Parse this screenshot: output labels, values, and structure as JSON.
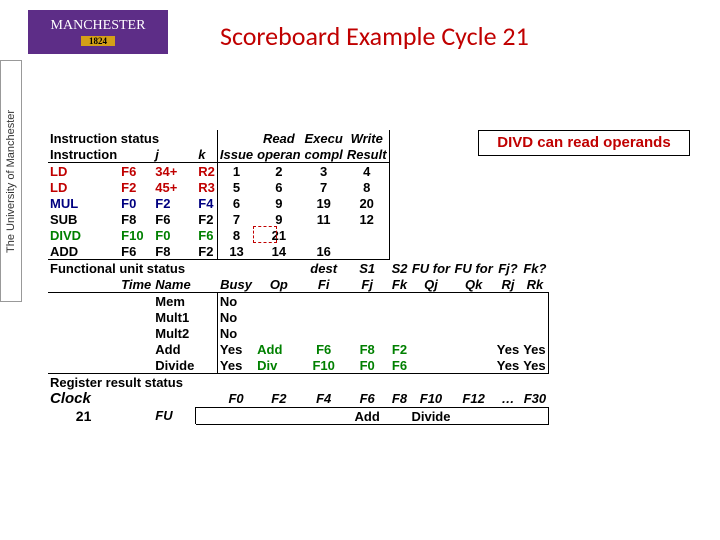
{
  "side_tab": "The University of Manchester",
  "logo": {
    "name": "MANCHESTER",
    "year": "1824"
  },
  "title": "Scoreboard Example Cycle 21",
  "note": "DIVD can read operands",
  "headers": {
    "instr_status": "Instruction status",
    "read": "Read",
    "exec": "Execu",
    "write": "Write",
    "instruction": "Instruction",
    "j": "j",
    "k": "k",
    "issue": "Issue",
    "oper": "operan",
    "compl": "compl",
    "result": "Result",
    "fu_status": "Functional unit status",
    "dest": "dest",
    "s1": "S1",
    "s2": "S2",
    "fu1": "FU for",
    "fu2": "FU for",
    "fjq": "Fj?",
    "fkq": "Fk?",
    "time": "Time",
    "name": "Name",
    "busy": "Busy",
    "op": "Op",
    "fi": "Fi",
    "fj": "Fj",
    "fk": "Fk",
    "qj": "Qj",
    "qk": "Qk",
    "rj": "Rj",
    "rk": "Rk",
    "reg_status": "Register result status",
    "clock": "Clock",
    "fu": "FU"
  },
  "instr": [
    {
      "op": "LD",
      "d": "F6",
      "j": "34+",
      "k": "R2",
      "c1": "1",
      "c2": "2",
      "c3": "3",
      "c4": "4"
    },
    {
      "op": "LD",
      "d": "F2",
      "j": "45+",
      "k": "R3",
      "c1": "5",
      "c2": "6",
      "c3": "7",
      "c4": "8"
    },
    {
      "op": "MUL",
      "d": "F0",
      "j": "F2",
      "k": "F4",
      "c1": "6",
      "c2": "9",
      "c3": "19",
      "c4": "20"
    },
    {
      "op": "SUB",
      "d": "F8",
      "j": "F6",
      "k": "F2",
      "c1": "7",
      "c2": "9",
      "c3": "11",
      "c4": "12"
    },
    {
      "op": "DIVD",
      "d": "F10",
      "j": "F0",
      "k": "F6",
      "c1": "8",
      "c2": "21",
      "c3": "",
      "c4": ""
    },
    {
      "op": "ADD",
      "d": "F6",
      "j": "F8",
      "k": "F2",
      "c1": "13",
      "c2": "14",
      "c3": "16",
      "c4": ""
    }
  ],
  "fu": [
    {
      "n": "Mem",
      "b": "No",
      "op": "",
      "fi": "",
      "fj": "",
      "fk": "",
      "qj": "",
      "qk": "",
      "rj": "",
      "rk": ""
    },
    {
      "n": "Mult1",
      "b": "No",
      "op": "",
      "fi": "",
      "fj": "",
      "fk": "",
      "qj": "",
      "qk": "",
      "rj": "",
      "rk": ""
    },
    {
      "n": "Mult2",
      "b": "No",
      "op": "",
      "fi": "",
      "fj": "",
      "fk": "",
      "qj": "",
      "qk": "",
      "rj": "",
      "rk": ""
    },
    {
      "n": "Add",
      "b": "Yes",
      "op": "Add",
      "fi": "F6",
      "fj": "F8",
      "fk": "F2",
      "qj": "",
      "qk": "",
      "rj": "Yes",
      "rk": "Yes"
    },
    {
      "n": "Divide",
      "b": "Yes",
      "op": "Div",
      "fi": "F10",
      "fj": "F0",
      "fk": "F6",
      "qj": "",
      "qk": "",
      "rj": "Yes",
      "rk": "Yes"
    }
  ],
  "regs": {
    "labels": [
      "F0",
      "F2",
      "F4",
      "F6",
      "F8",
      "F10",
      "F12",
      "…",
      "F30"
    ],
    "vals": [
      "",
      "",
      "",
      "Add",
      "",
      "Divide",
      "",
      "",
      ""
    ]
  },
  "clock": "21"
}
